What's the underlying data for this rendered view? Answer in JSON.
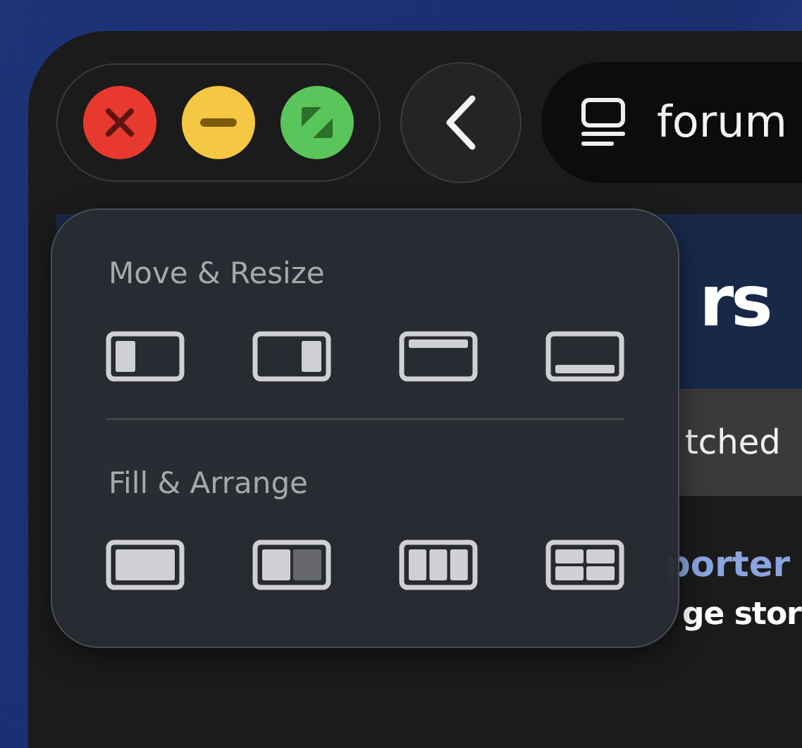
{
  "toolbar": {
    "address": "forum"
  },
  "page": {
    "heading": "rs",
    "tab_text": "tched",
    "link_text": "porter",
    "bold_text": "ge stor"
  },
  "menu": {
    "sections": [
      {
        "title": "Move & Resize",
        "items": [
          {
            "kind": "left"
          },
          {
            "kind": "right"
          },
          {
            "kind": "top"
          },
          {
            "kind": "bottom"
          }
        ]
      },
      {
        "title": "Fill & Arrange",
        "items": [
          {
            "kind": "fill"
          },
          {
            "kind": "split"
          },
          {
            "kind": "thirds"
          },
          {
            "kind": "quarters"
          }
        ]
      }
    ]
  }
}
